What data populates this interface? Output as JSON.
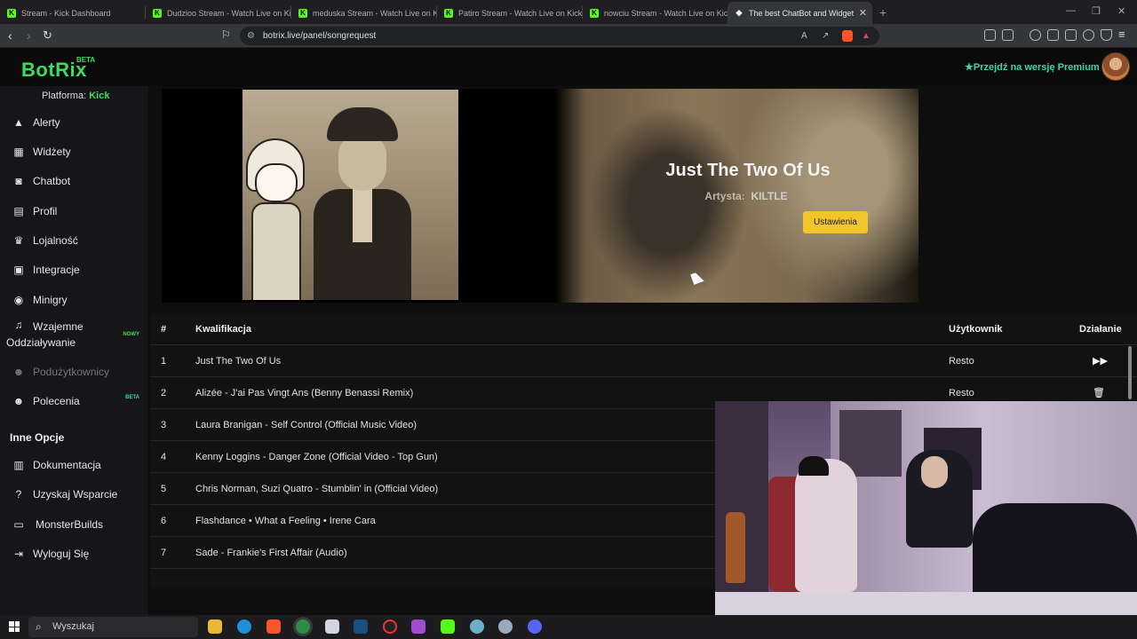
{
  "browser": {
    "tabs": [
      {
        "title": "Stream - Kick Dashboard",
        "icon": "kick-logo-icon"
      },
      {
        "title": "Dudzioo Stream - Watch Live on Kick",
        "icon": "kick-logo-icon"
      },
      {
        "title": "meduska Stream - Watch Live on Kick",
        "icon": "kick-logo-icon"
      },
      {
        "title": "Patiro Stream - Watch Live on Kick",
        "icon": "kick-logo-icon"
      },
      {
        "title": "nowciu Stream - Watch Live on Kick",
        "icon": "kick-logo-icon"
      },
      {
        "title": "The best ChatBot and Widget",
        "icon": "botrix-logo-icon"
      }
    ],
    "url": "botrix.live/panel/songrequest"
  },
  "app": {
    "logo": "BotRix",
    "logo_badge": "BETA",
    "premium_label": "Przejdź na wersję Premium",
    "platform_label": "Platforma:",
    "platform_value": "Kick"
  },
  "sidebar": {
    "items": [
      {
        "label": "Alerty",
        "icon": "warning-icon"
      },
      {
        "label": "Widżety",
        "icon": "grid-icon"
      },
      {
        "label": "Chatbot",
        "icon": "robot-icon"
      },
      {
        "label": "Profil",
        "icon": "id-card-icon"
      },
      {
        "label": "Lojalność",
        "icon": "trophy-icon"
      },
      {
        "label": "Integracje",
        "icon": "plug-icon"
      },
      {
        "label": "Minigry",
        "icon": "gamepad-icon"
      },
      {
        "label": "Wzajemne Oddziaływanie",
        "icon": "music-icon",
        "badge": "NOWY"
      },
      {
        "label": "Podużytkownicy",
        "icon": "users-icon",
        "disabled": true
      },
      {
        "label": "Polecenia",
        "icon": "users-icon",
        "badge": "BETA"
      }
    ],
    "section_other": "Inne Opcje",
    "other_items": [
      {
        "label": "Dokumentacja",
        "icon": "book-icon"
      },
      {
        "label": "Uzyskaj Wsparcie",
        "icon": "question-icon"
      },
      {
        "label": "MonsterBuilds",
        "icon": "laptop-icon"
      },
      {
        "label": "Wyloguj Się",
        "icon": "logout-icon"
      }
    ]
  },
  "now_playing": {
    "title": "Just The Two Of Us",
    "artist_label": "Artysta:",
    "artist": "KILTLE",
    "settings_button": "Ustawienia"
  },
  "queue": {
    "headers": {
      "num": "#",
      "title": "Kwalifikacja",
      "user": "Użytkownik",
      "action": "Działanie"
    },
    "rows": [
      {
        "num": "1",
        "title": "Just The Two Of Us",
        "user": "Resto",
        "action": "play-next-icon"
      },
      {
        "num": "2",
        "title": "Alizée - J'ai Pas Vingt Ans (Benny Benassi Remix)",
        "user": "Resto",
        "action": "trash-icon"
      },
      {
        "num": "3",
        "title": "Laura Branigan - Self Control (Official Music Video)",
        "user": "",
        "action": ""
      },
      {
        "num": "4",
        "title": "Kenny Loggins - Danger Zone (Official Video - Top Gun)",
        "user": "",
        "action": ""
      },
      {
        "num": "5",
        "title": "Chris Norman, Suzi Quatro - Stumblin' in (Official Video)",
        "user": "",
        "action": ""
      },
      {
        "num": "6",
        "title": "Flashdance • What a Feeling • Irene Cara",
        "user": "",
        "action": ""
      },
      {
        "num": "7",
        "title": "Sade - Frankie's First Affair (Audio)",
        "user": "",
        "action": ""
      }
    ]
  },
  "taskbar": {
    "search_placeholder": "Wyszukaj"
  },
  "colors": {
    "brand_green": "#3ddc5a",
    "premium_teal": "#3fd4a8",
    "button_yellow": "#f3c52c"
  }
}
